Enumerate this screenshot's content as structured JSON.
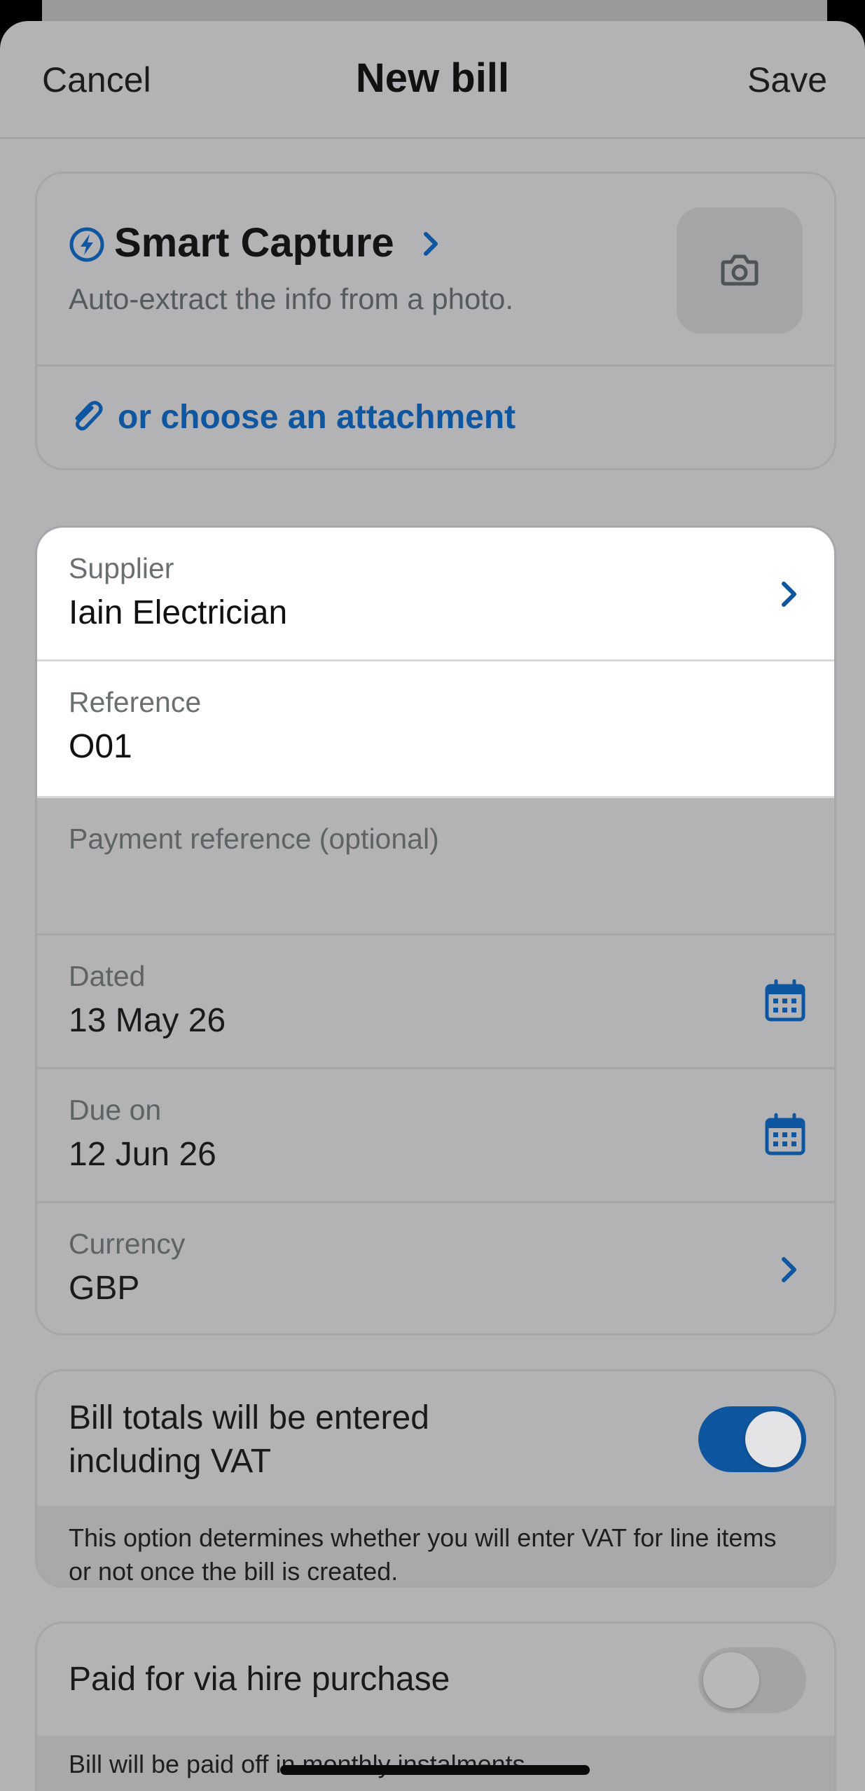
{
  "nav": {
    "cancel_label": "Cancel",
    "title": "New bill",
    "save_label": "Save"
  },
  "capture": {
    "title": "Smart Capture",
    "subtitle": "Auto-extract the info from a photo.",
    "attach_label": "or choose an attachment"
  },
  "form": {
    "supplier_label": "Supplier",
    "supplier_value": "Iain Electrician",
    "reference_label": "Reference",
    "reference_value": "O01",
    "payment_ref_placeholder": "Payment reference (optional)",
    "dated_label": "Dated",
    "dated_value": "13 May 26",
    "due_label": "Due on",
    "due_value": "12 Jun 26",
    "currency_label": "Currency",
    "currency_value": "GBP"
  },
  "vat": {
    "label": "Bill totals will be entered including VAT",
    "enabled": true,
    "help": "This option determines whether you will enter VAT for line items or not once the bill is created."
  },
  "hire_purchase": {
    "label": "Paid for via hire purchase",
    "enabled": false,
    "help": "Bill will be paid off in monthly instalments."
  },
  "colors": {
    "accent": "#0f56a0",
    "overlay_bg": "#b3b3b5"
  }
}
